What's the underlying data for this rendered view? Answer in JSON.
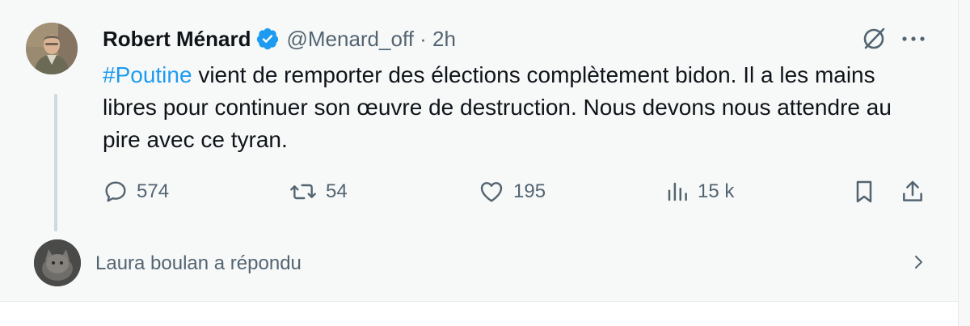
{
  "tweet": {
    "author_name": "Robert Ménard",
    "handle_and_time": "@Menard_off · 2h",
    "hashtag": "#Poutine",
    "text": " vient de remporter des élections complètement bidon. Il a les mains libres pour continuer son œuvre de destruction. Nous devons nous attendre au pire avec ce tyran.",
    "actions": {
      "replies": "574",
      "retweets": "54",
      "likes": "195",
      "views": "15 k"
    }
  },
  "reply_notice": {
    "text": "Laura boulan a répondu"
  },
  "icons": {
    "verified": "verified-badge-icon",
    "grok": "grok-icon",
    "more": "more-icon",
    "reply": "reply-icon",
    "retweet": "retweet-icon",
    "like": "heart-icon",
    "views": "views-icon",
    "bookmark": "bookmark-icon",
    "share": "share-icon",
    "chevron": "chevron-right-icon"
  },
  "colors": {
    "accent": "#1d9bf0",
    "muted": "#536471",
    "text": "#0f1419",
    "background": "#f7f9f9"
  }
}
